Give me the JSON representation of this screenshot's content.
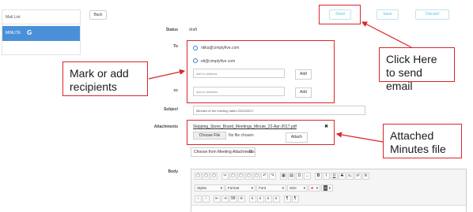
{
  "sidebar": {
    "mail_list_label": "Mail List",
    "minute_label": "MINUTE",
    "minute_icon": "G"
  },
  "toolbar": {
    "back_label": "Back",
    "send_label": "Send",
    "save_label": "Save",
    "discard_label": "Discard"
  },
  "form": {
    "status_label": "Status",
    "status_value": "draft",
    "to_label": "To",
    "recipients": [
      {
        "email": "ritika@cimplyfive.com"
      },
      {
        "email": "eti@cimplyfive.com"
      }
    ],
    "to_placeholder": "add to address",
    "add_label": "Add",
    "cc_label": "cc",
    "cc_placeholder": "add cc address",
    "subject_label": "Subject",
    "subject_value": "Minutes of the meeting dated 22/04/2017",
    "attachments_label": "Attachments",
    "attachment_file": "Skipping_Stone_Board_Meetings_Minute_22-Apr-2017.pdf",
    "remove_symbol": "✖",
    "choose_file_label": "Choose File",
    "no_file_label": "No file chosen",
    "attach_label": "Attach",
    "meeting_attach_label": "Choose from Meeting Attachments",
    "body_label": "Body"
  },
  "editor": {
    "row1": [
      "▢",
      "▢",
      "▢",
      "✂",
      "▢",
      "▢",
      "▢",
      "▢",
      "↶",
      "↷",
      "▦",
      "▤",
      "Ω",
      "↔",
      "B",
      "I",
      "U",
      "S",
      "x₂",
      "x²",
      "Ix"
    ],
    "styles_label": "Styles",
    "format_label": "Format",
    "font_label": "Font",
    "size_label": "Size",
    "dropdown_arrow": "▾",
    "color_a": "A",
    "row3": [
      "⁝",
      "⁝",
      "⇤",
      "⇥",
      "99",
      "⁜",
      "≡",
      "≡",
      "≡",
      "≡",
      "¶",
      "¶"
    ]
  },
  "annotations": {
    "send": "Click Here to send email",
    "recipients": "Mark or add recipients",
    "attached": "Attached Minutes file"
  },
  "colors": {
    "accent": "#4a90d9",
    "annotation_red": "#d9262b",
    "button_text": "#5bc0de"
  }
}
